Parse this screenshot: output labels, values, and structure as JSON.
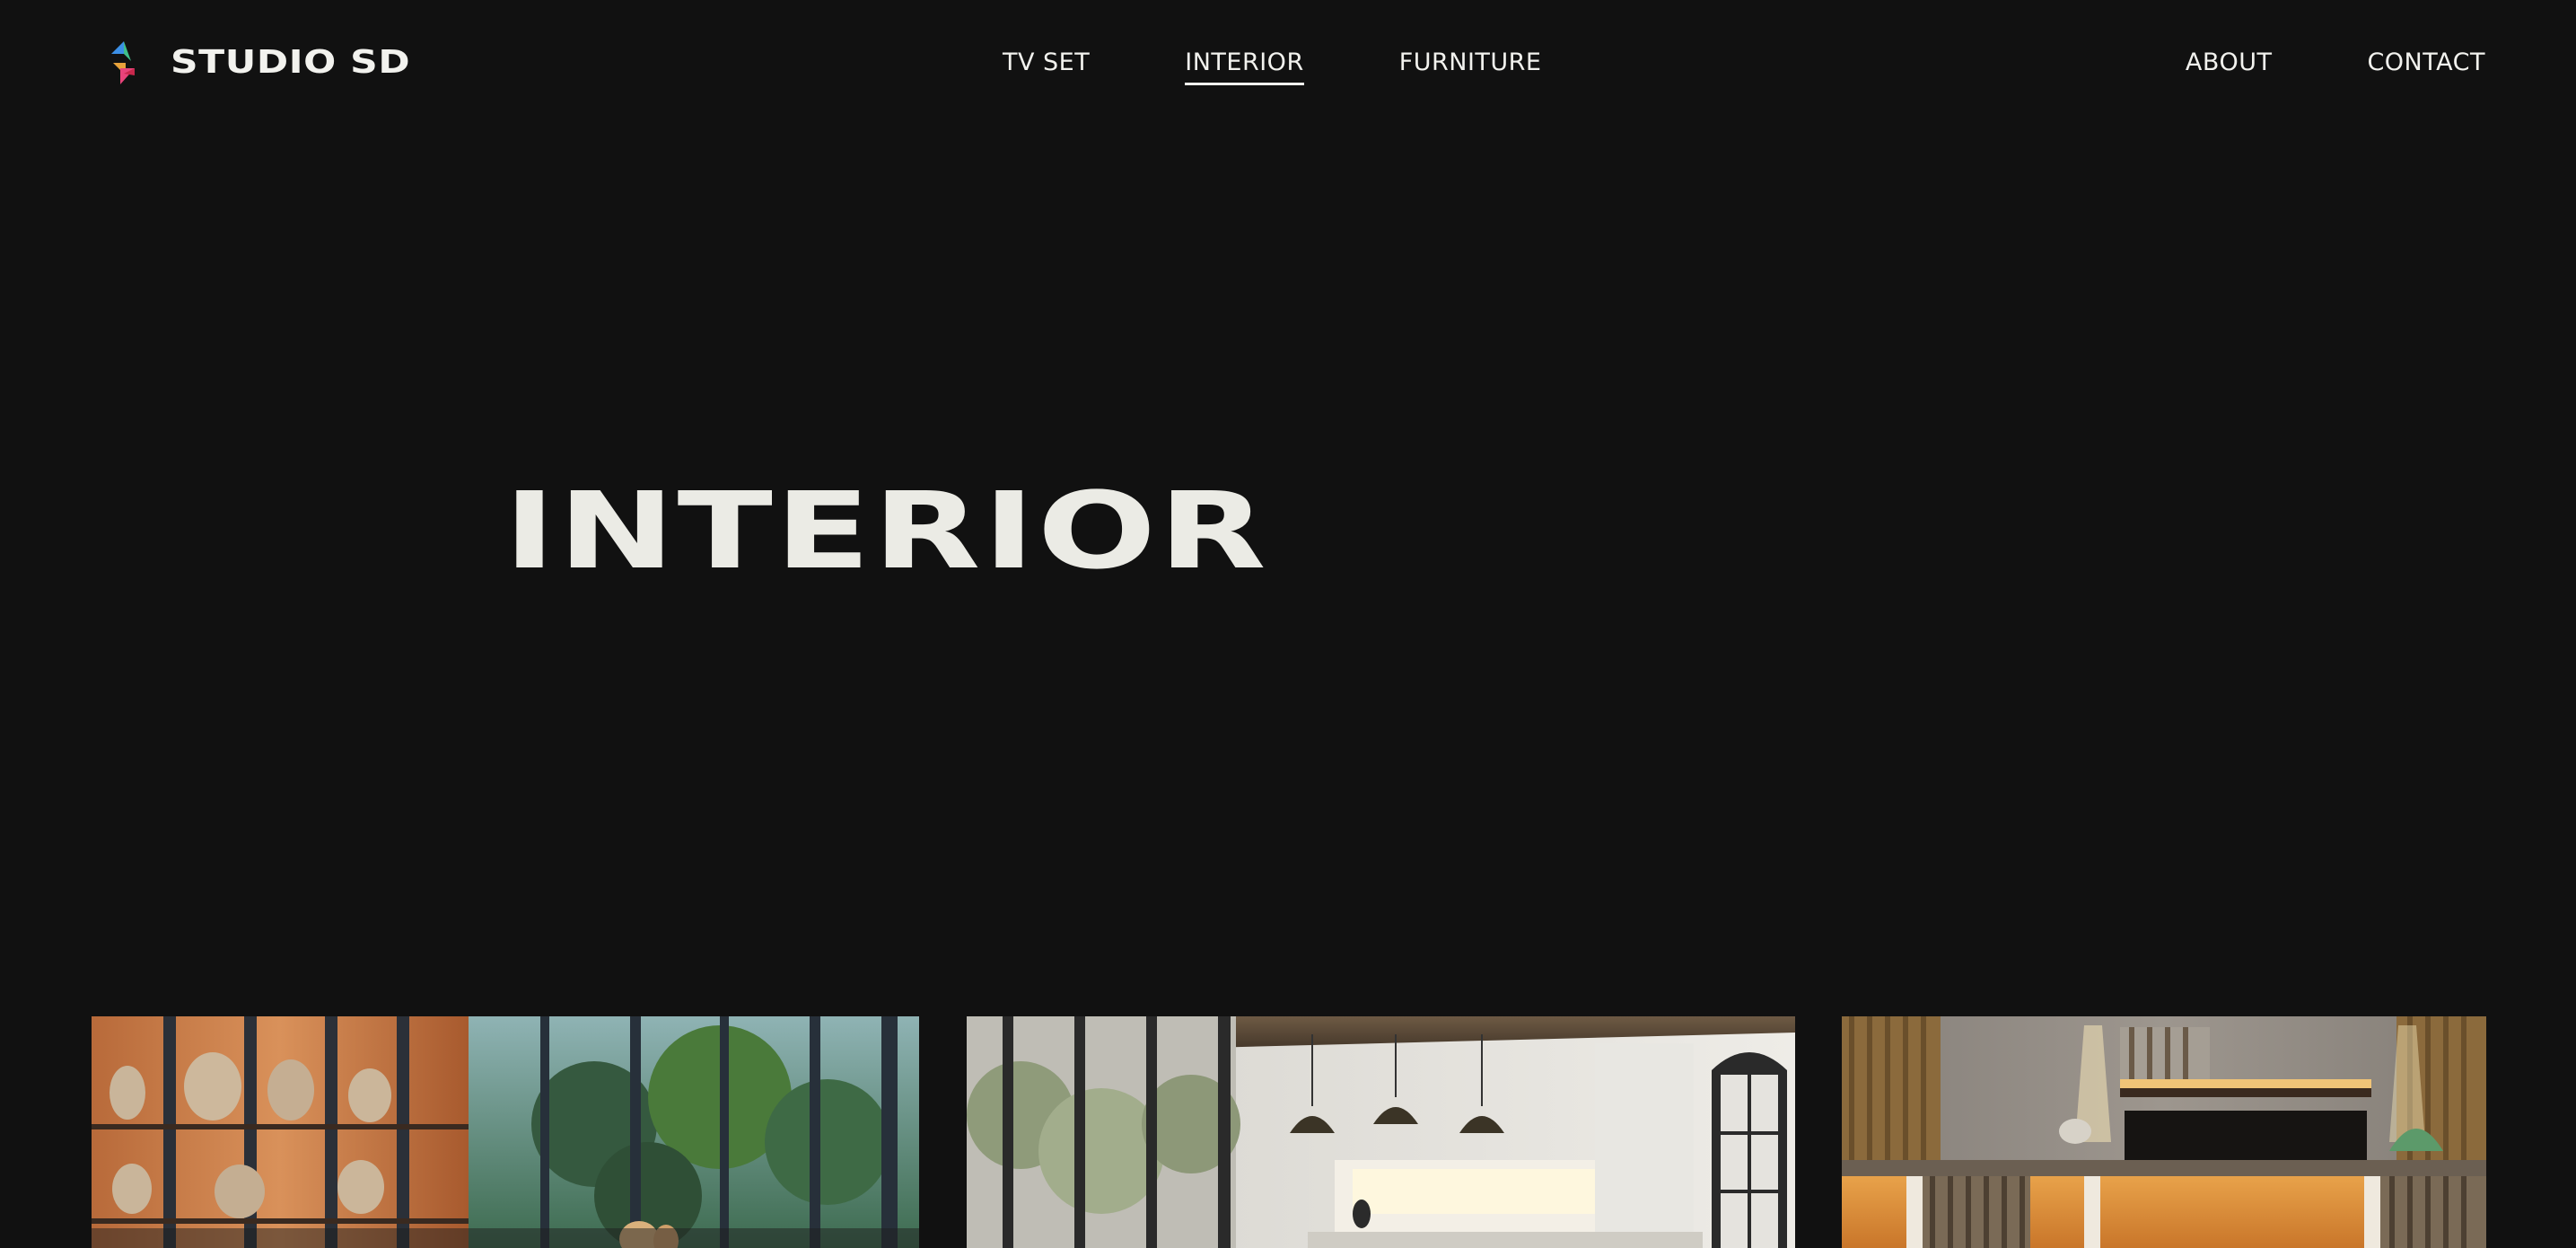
{
  "header": {
    "brand": "STUDIO SD",
    "nav_center": [
      {
        "label": "TV SET",
        "active": false
      },
      {
        "label": "INTERIOR",
        "active": true
      },
      {
        "label": "FURNITURE",
        "active": false
      }
    ],
    "nav_right": [
      {
        "label": "ABOUT"
      },
      {
        "label": "CONTACT"
      }
    ]
  },
  "hero": {
    "title": "INTERIOR"
  },
  "gallery": {
    "items": [
      {
        "subject": "interior with vase shelves and garden windows"
      },
      {
        "subject": "kitchen with pendant lamps and arched window"
      },
      {
        "subject": "warm lit lounge with slatted cabinets"
      }
    ]
  },
  "colors": {
    "background": "#111111",
    "text": "#f2f2ee",
    "logo_blue": "#3b8fe6",
    "logo_green": "#3fbf8a",
    "logo_pink": "#e8437a",
    "logo_red": "#c8284c"
  },
  "icons": {
    "logo": "studio-sd-logo-icon"
  }
}
